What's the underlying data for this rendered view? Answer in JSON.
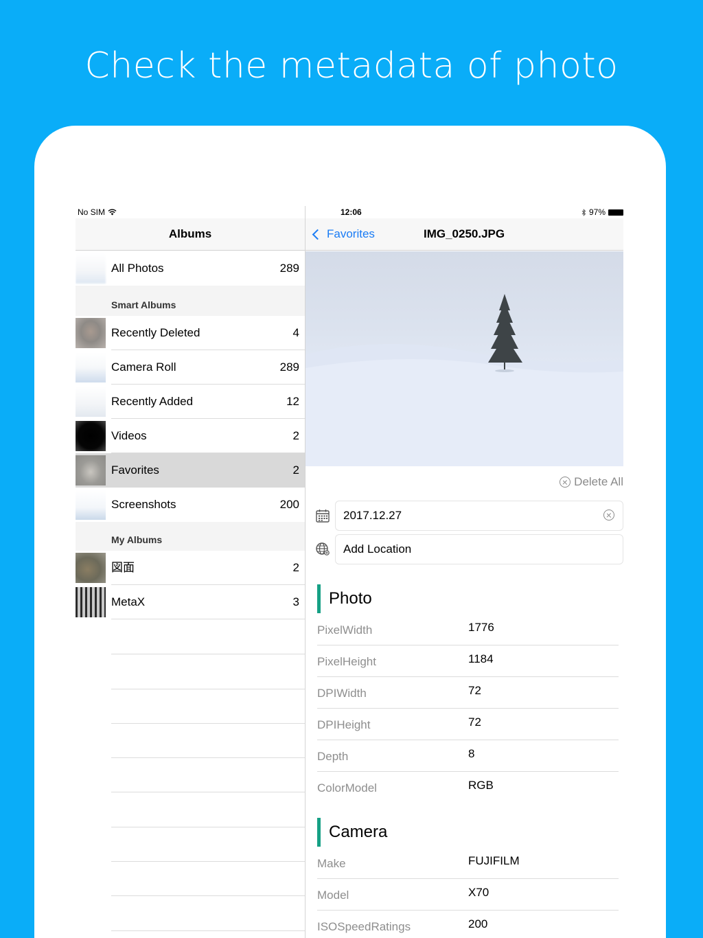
{
  "headline": "Check the metadata of photo",
  "status": {
    "carrier": "No SIM",
    "time": "12:06",
    "battery": "97%"
  },
  "master": {
    "title": "Albums",
    "top": [
      {
        "name": "All Photos",
        "count": "289"
      }
    ],
    "smart_header": "Smart Albums",
    "smart": [
      {
        "name": "Recently Deleted",
        "count": "4"
      },
      {
        "name": "Camera Roll",
        "count": "289"
      },
      {
        "name": "Recently Added",
        "count": "12"
      },
      {
        "name": "Videos",
        "count": "2"
      },
      {
        "name": "Favorites",
        "count": "2"
      },
      {
        "name": "Screenshots",
        "count": "200"
      }
    ],
    "my_header": "My Albums",
    "mine": [
      {
        "name": "図面",
        "count": "2"
      },
      {
        "name": "MetaX",
        "count": "3"
      }
    ]
  },
  "detail": {
    "back_label": "Favorites",
    "title": "IMG_0250.JPG",
    "delete_all": "Delete All",
    "date_value": "2017.12.27",
    "location_value": "Add Location",
    "photo_section": "Photo",
    "photo_rows": [
      {
        "key": "PixelWidth",
        "value": "1776"
      },
      {
        "key": "PixelHeight",
        "value": "1184"
      },
      {
        "key": "DPIWidth",
        "value": "72"
      },
      {
        "key": "DPIHeight",
        "value": "72"
      },
      {
        "key": "Depth",
        "value": "8"
      },
      {
        "key": "ColorModel",
        "value": "RGB"
      }
    ],
    "camera_section": "Camera",
    "camera_rows": [
      {
        "key": "Make",
        "value": "FUJIFILM"
      },
      {
        "key": "Model",
        "value": "X70"
      },
      {
        "key": "ISOSpeedRatings",
        "value": "200"
      }
    ]
  },
  "colors": {
    "background": "#0aadf8",
    "accent_blue": "#1a7cf5",
    "section_bar": "#16a085"
  }
}
